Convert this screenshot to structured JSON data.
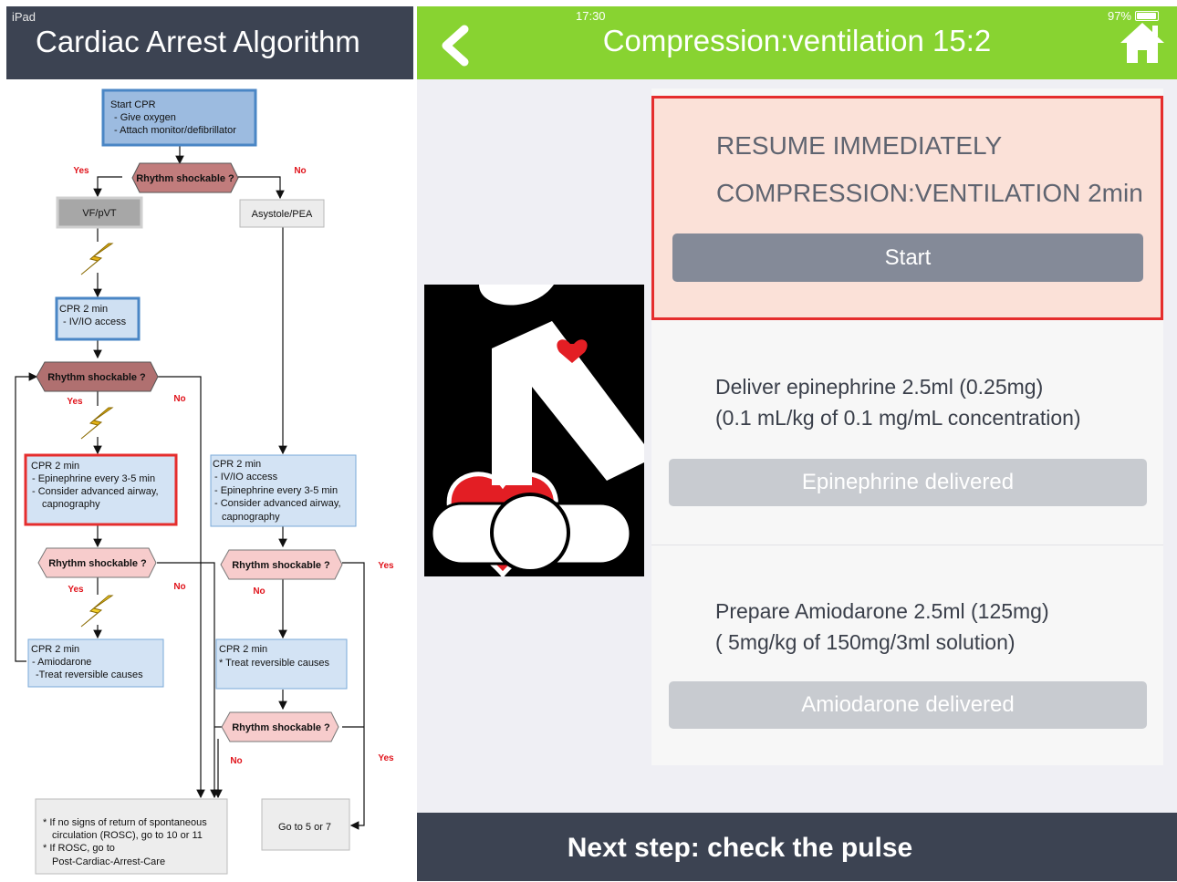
{
  "left": {
    "device": "iPad",
    "title": "Cardiac Arrest Algorithm",
    "flowchart": {
      "start_title": "Start CPR",
      "start_items": [
        "- Give oxygen",
        "- Attach monitor/defibrillator"
      ],
      "rhythm_q": "Rhythm shockable ?",
      "yes": "Yes",
      "no": "No",
      "vf": "VF/pVT",
      "asystole": "Asystole/PEA",
      "cpr_a_title": "CPR 2 min",
      "cpr_a_items": [
        "- IV/IO access"
      ],
      "cpr_b_title": "CPR 2 min",
      "cpr_b_items": [
        "- Epinephrine every 3-5 min",
        "- Consider advanced airway,",
        "capnography"
      ],
      "cpr_c_title": "CPR 2 min",
      "cpr_c_items": [
        "- IV/IO access",
        "- Epinephrine every 3-5 min",
        "- Consider advanced airway,",
        "capnography"
      ],
      "cpr_d_title": "CPR 2 min",
      "cpr_d_items": [
        "- Amiodarone",
        "-Treat reversible causes"
      ],
      "cpr_e_title": "CPR 2 min",
      "cpr_e_items": [
        "* Treat reversible causes"
      ],
      "final_items": [
        "* If no signs of return of spontaneous",
        "circulation (ROSC), go to 10 or 11",
        "* If ROSC, go to",
        "Post-Cardiac-Arrest-Care"
      ],
      "goto": "Go to 5 or 7"
    }
  },
  "right": {
    "status_time": "17:30",
    "battery": "97%",
    "battery_level": 0.97,
    "title": "Compression:ventilation 15:2",
    "resume_line1": "RESUME IMMEDIATELY",
    "resume_line2": "COMPRESSION:VENTILATION 2min",
    "start_label": "Start",
    "epi_line1": "Deliver epinephrine 2.5ml (0.25mg)",
    "epi_line2": "(0.1 mL/kg of 0.1 mg/mL concentration)",
    "epi_button": "Epinephrine delivered",
    "amio_line1": "Prepare Amiodarone 2.5ml (125mg)",
    "amio_line2": "( 5mg/kg of 150mg/3ml solution)",
    "amio_button": "Amiodarone delivered",
    "next_step": "Next step: check the pulse"
  },
  "colors": {
    "header_dark": "#3c4352",
    "top_bar_green": "#88d331",
    "highlight_red": "#e52d2d",
    "resume_bg": "#fbe1d8",
    "start_button": "#848a98",
    "disabled_button": "#c8cbd0"
  },
  "icons": [
    "back-chevron-icon",
    "home-icon",
    "lightning-icon",
    "cpr-mascot-image"
  ]
}
